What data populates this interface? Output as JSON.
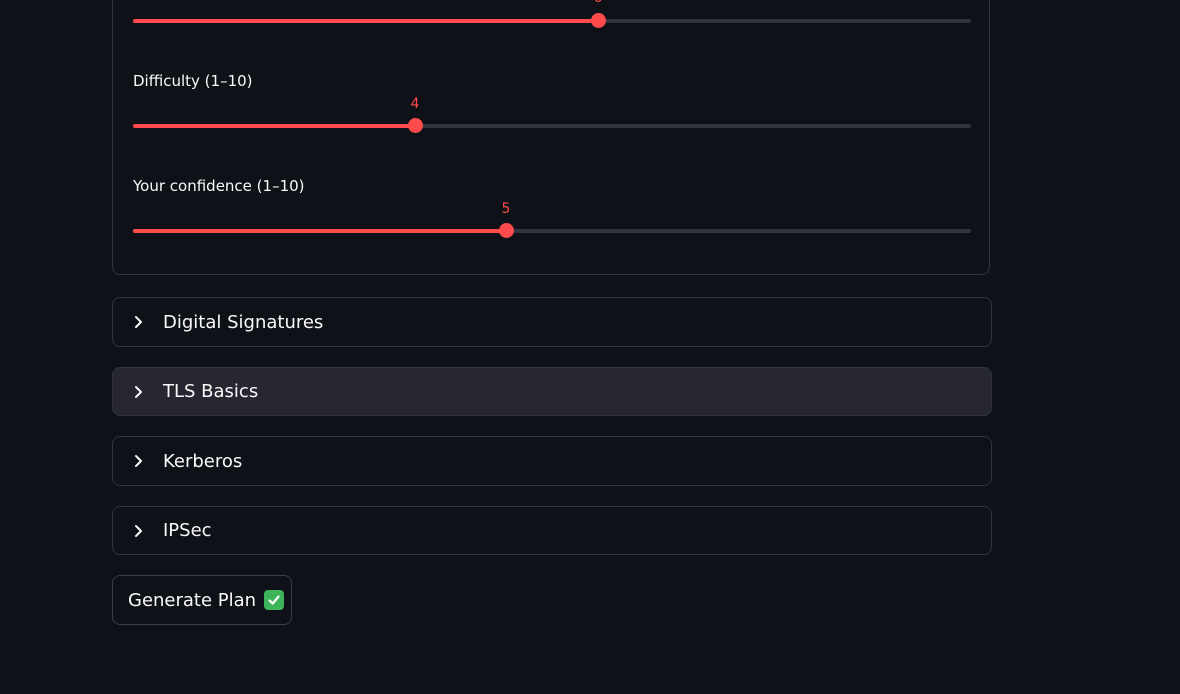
{
  "sliders": [
    {
      "label": "",
      "value": "6",
      "min": 1,
      "max": 10,
      "fraction": 0.555
    },
    {
      "label": "Difficulty (1–10)",
      "value": "4",
      "min": 1,
      "max": 10,
      "fraction": 0.336
    },
    {
      "label": "Your confidence (1–10)",
      "value": "5",
      "min": 1,
      "max": 10,
      "fraction": 0.444
    }
  ],
  "expanders": [
    {
      "title": "Digital Signatures",
      "icon": "chevron-right-icon"
    },
    {
      "title": "TLS Basics",
      "icon": "chevron-right-icon"
    },
    {
      "title": "Kerberos",
      "icon": "chevron-right-icon"
    },
    {
      "title": "IPSec",
      "icon": "chevron-right-icon"
    }
  ],
  "generate_button": {
    "label": "Generate Plan",
    "icon": "check-mark-icon"
  },
  "colors": {
    "accent": "#ff4b4b",
    "background": "#0e1117",
    "track": "#31333f",
    "border": "#31333f",
    "hover": "#262730",
    "check": "#3cb55a"
  }
}
